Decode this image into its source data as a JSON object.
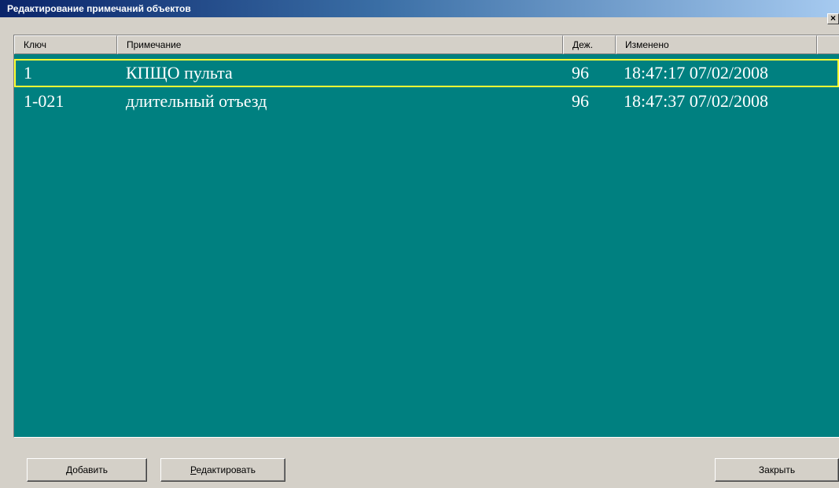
{
  "window": {
    "title": "Редактирование примечаний объектов",
    "close_glyph": "×"
  },
  "table": {
    "columns": [
      "Ключ",
      "Примечание",
      "Деж.",
      "Изменено"
    ],
    "rows": [
      {
        "key": "1",
        "note": "КПЩО пульта",
        "duty": "96",
        "changed": "18:47:17 07/02/2008",
        "selected": true
      },
      {
        "key": "1-021",
        "note": "длительный отъезд",
        "duty": "96",
        "changed": "18:47:37 07/02/2008",
        "selected": false
      }
    ],
    "background": "#008080",
    "selection_color": "#ffff33"
  },
  "buttons": {
    "add": {
      "mnemonic": "Д",
      "rest": "обавить"
    },
    "edit": {
      "mnemonic": "Р",
      "rest": "едактировать"
    },
    "close": "Закрыть"
  }
}
